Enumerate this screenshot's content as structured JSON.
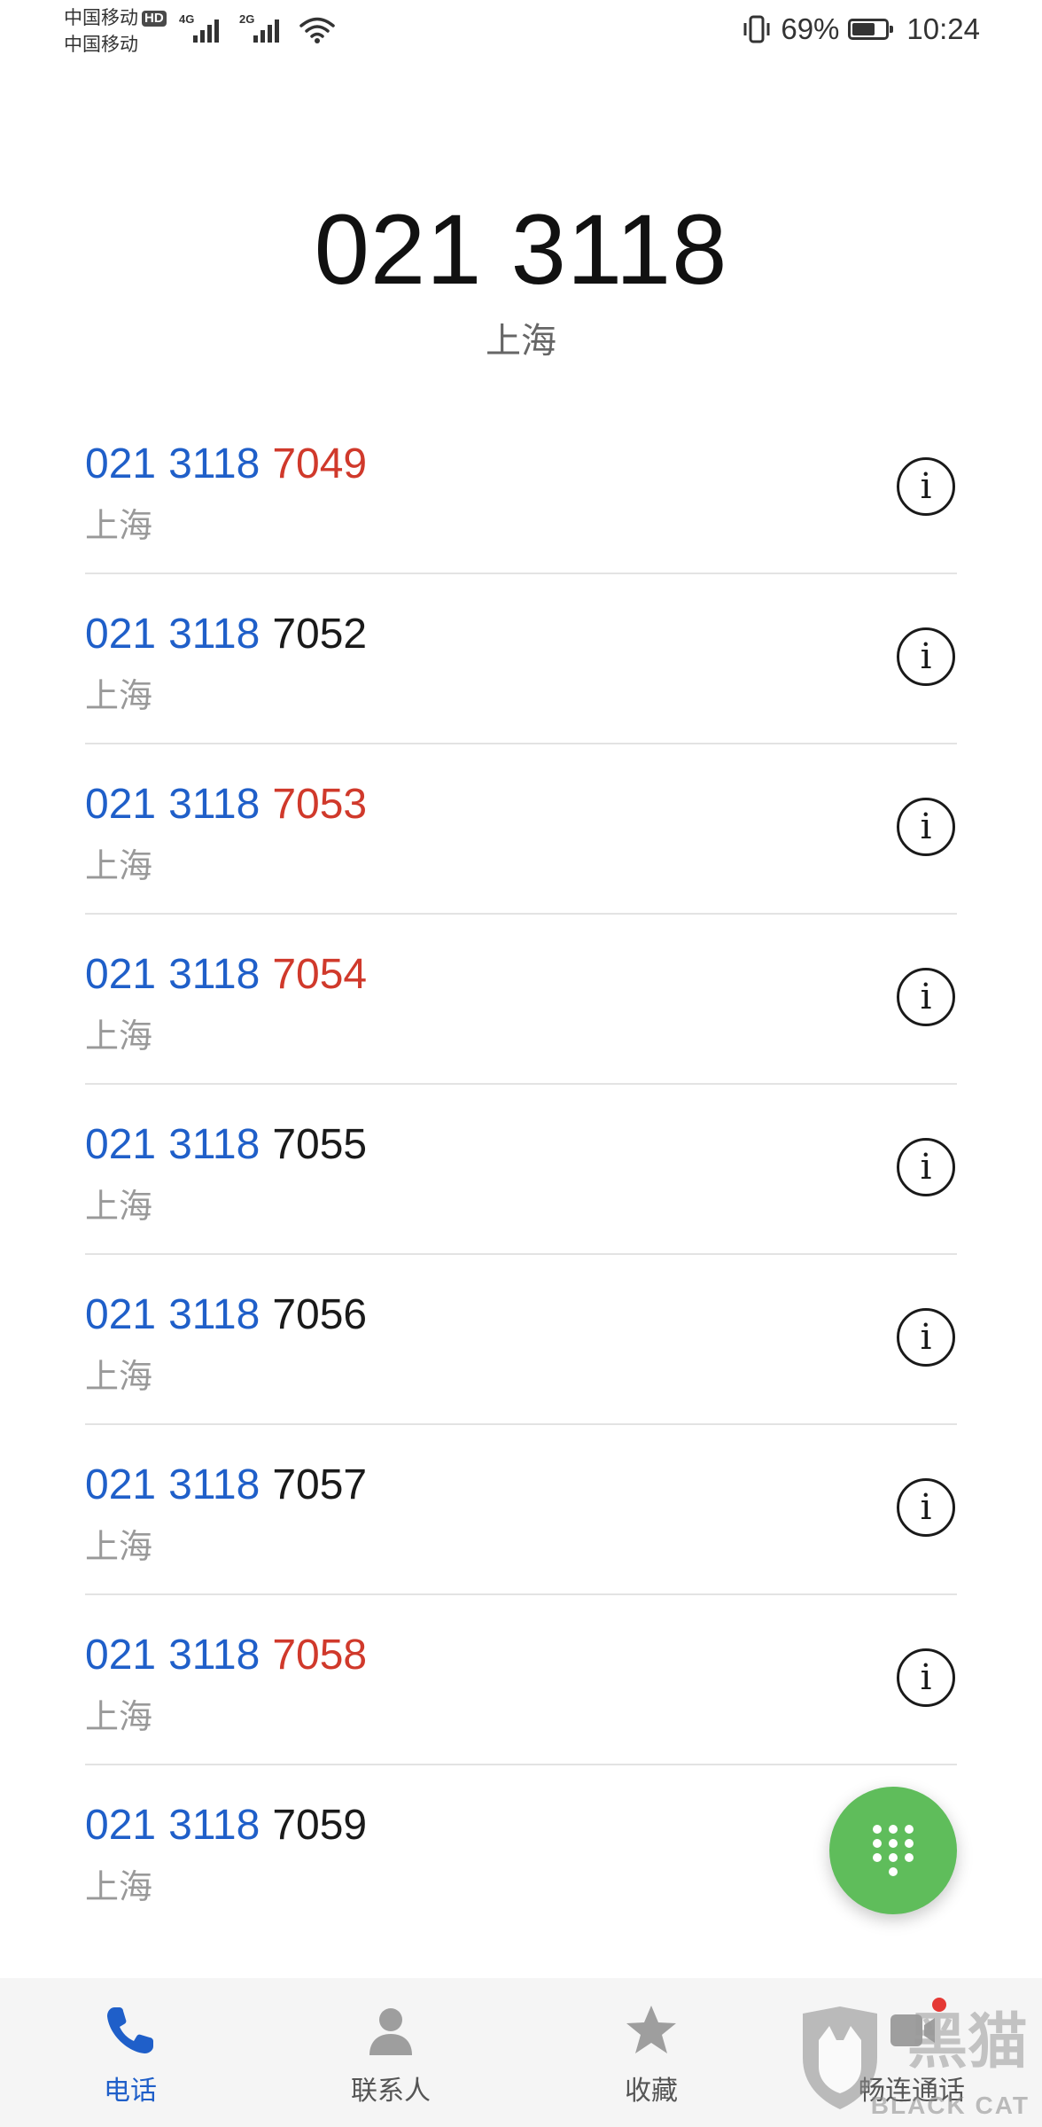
{
  "status_bar": {
    "carrier1": "中国移动",
    "hd_badge": "HD",
    "carrier2": "中国移动",
    "sim1_tag": "4G",
    "sim2_tag": "2G",
    "battery_percent": "69%",
    "battery_level": 0.69,
    "time": "10:24"
  },
  "header": {
    "dialed_number": "021 3118",
    "location": "上海"
  },
  "results": [
    {
      "prefix1": "021",
      "prefix2": "3118",
      "suffix": "7049",
      "highlighted": true,
      "location": "上海"
    },
    {
      "prefix1": "021",
      "prefix2": "3118",
      "suffix": "7052",
      "highlighted": false,
      "location": "上海"
    },
    {
      "prefix1": "021",
      "prefix2": "3118",
      "suffix": "7053",
      "highlighted": true,
      "location": "上海"
    },
    {
      "prefix1": "021",
      "prefix2": "3118",
      "suffix": "7054",
      "highlighted": true,
      "location": "上海"
    },
    {
      "prefix1": "021",
      "prefix2": "3118",
      "suffix": "7055",
      "highlighted": false,
      "location": "上海"
    },
    {
      "prefix1": "021",
      "prefix2": "3118",
      "suffix": "7056",
      "highlighted": false,
      "location": "上海"
    },
    {
      "prefix1": "021",
      "prefix2": "3118",
      "suffix": "7057",
      "highlighted": false,
      "location": "上海"
    },
    {
      "prefix1": "021",
      "prefix2": "3118",
      "suffix": "7058",
      "highlighted": true,
      "location": "上海"
    },
    {
      "prefix1": "021",
      "prefix2": "3118",
      "suffix": "7059",
      "highlighted": false,
      "location": "上海"
    }
  ],
  "info_icon": "info-icon",
  "fab_icon": "dialpad-icon",
  "bottom_nav": [
    {
      "id": "phone",
      "label": "电话",
      "icon": "phone-icon",
      "active": true
    },
    {
      "id": "contacts",
      "label": "联系人",
      "icon": "contact-icon",
      "active": false
    },
    {
      "id": "favorites",
      "label": "收藏",
      "icon": "star-icon",
      "active": false
    },
    {
      "id": "meetime",
      "label": "畅连通话",
      "icon": "meetime-icon",
      "active": false
    }
  ],
  "watermark": {
    "logo_text": "黑猫",
    "sub_text": "BLACK CAT"
  },
  "colors": {
    "prefix_blue": "#1f5fc9",
    "highlight_red": "#d0392b",
    "fab_green": "#5fbd5b",
    "active_nav": "#1f5fc9"
  }
}
